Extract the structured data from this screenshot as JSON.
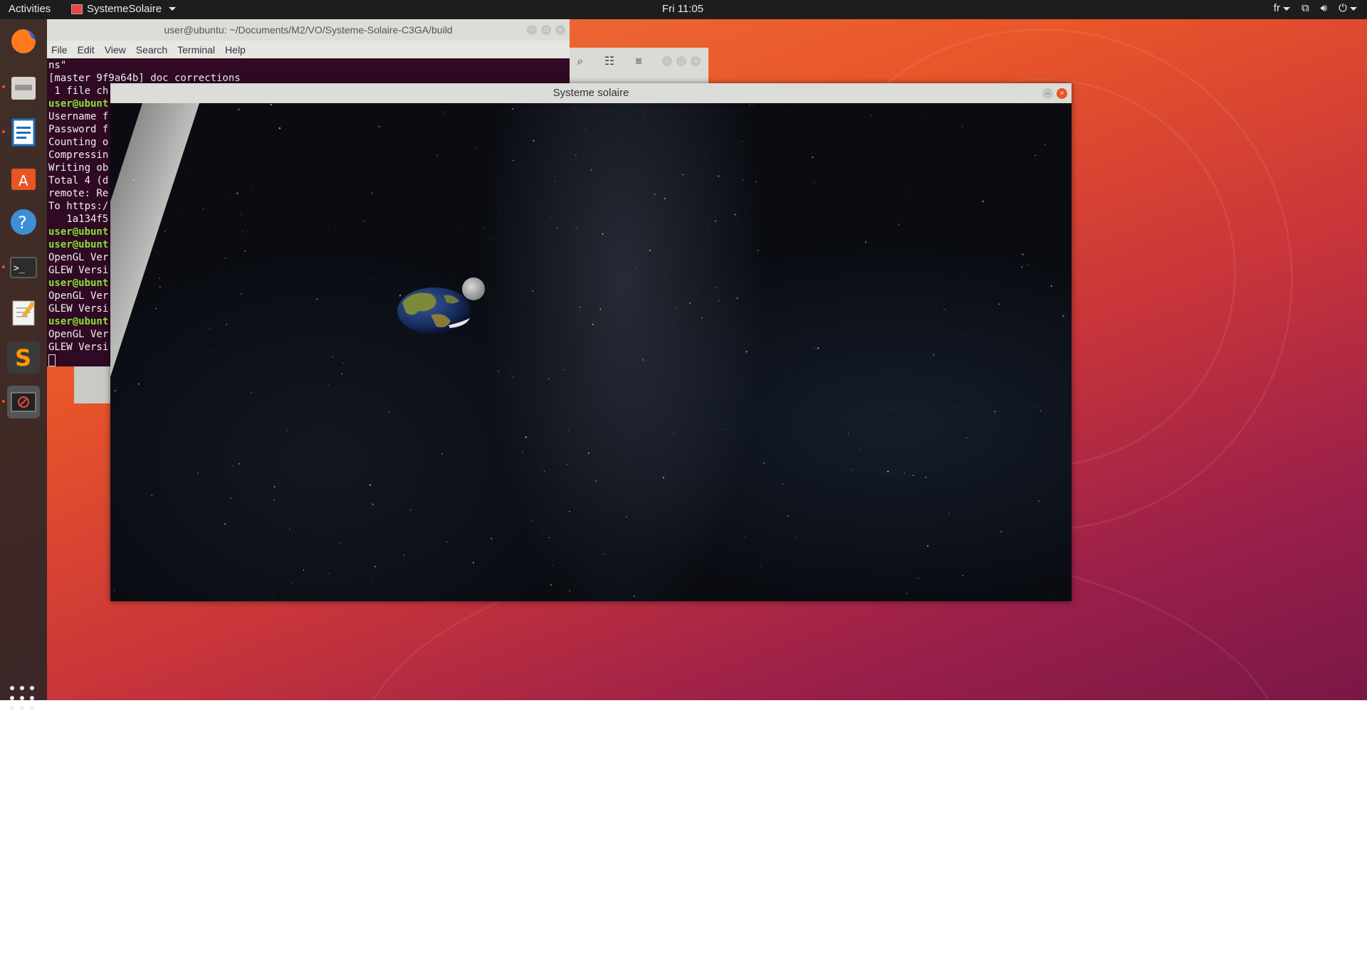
{
  "topbar": {
    "activities": "Activities",
    "app_name": "SystemeSolaire",
    "clock": "Fri 11:05",
    "lang": "fr"
  },
  "dock": {
    "items": [
      "firefox-icon",
      "files-icon",
      "writer-icon",
      "software-icon",
      "help-icon",
      "terminal-icon",
      "text-editor-icon",
      "sublime-icon",
      "running-app-icon"
    ]
  },
  "terminal": {
    "title": "user@ubuntu: ~/Documents/M2/VO/Systeme-Solaire-C3GA/build",
    "menu": [
      "File",
      "Edit",
      "View",
      "Search",
      "Terminal",
      "Help"
    ],
    "lines": [
      {
        "t": "ns\"",
        "g": false
      },
      {
        "t": "[master 9f9a64b] doc corrections",
        "g": false
      },
      {
        "t": " 1 file ch",
        "g": false
      },
      {
        "t": "user@ubunt",
        "g": true
      },
      {
        "t": "Username f",
        "g": false
      },
      {
        "t": "Password f",
        "g": false
      },
      {
        "t": "Counting o",
        "g": false
      },
      {
        "t": "Compressin",
        "g": false
      },
      {
        "t": "Writing ob",
        "g": false
      },
      {
        "t": "Total 4 (d",
        "g": false
      },
      {
        "t": "remote: Re",
        "g": false
      },
      {
        "t": "To https:/",
        "g": false
      },
      {
        "t": "   1a134f5",
        "g": false
      },
      {
        "t": "user@ubunt",
        "g": true
      },
      {
        "t": "user@ubunt",
        "g": true
      },
      {
        "t": "OpenGL Ver",
        "g": false
      },
      {
        "t": "GLEW Versi",
        "g": false
      },
      {
        "t": "user@ubunt",
        "g": true
      },
      {
        "t": "OpenGL Ver",
        "g": false
      },
      {
        "t": "GLEW Versi",
        "g": false
      },
      {
        "t": "user@ubunt",
        "g": true
      },
      {
        "t": "OpenGL Ver",
        "g": false
      },
      {
        "t": "GLEW Versi",
        "g": false
      }
    ]
  },
  "glwindow": {
    "title": "Systeme solaire"
  },
  "colors": {
    "accent": "#e95420",
    "terminal_bg": "#300a24",
    "prompt": "#8ae234"
  }
}
